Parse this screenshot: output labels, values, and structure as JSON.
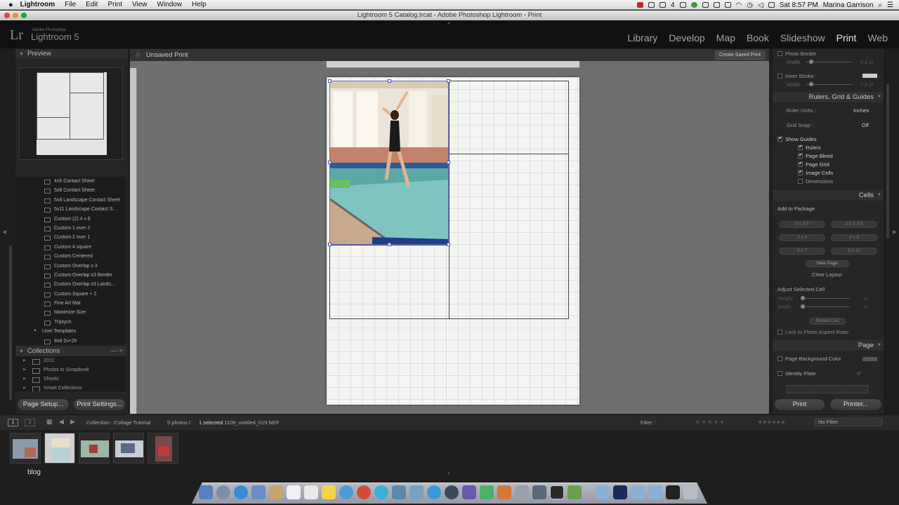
{
  "menubar": {
    "apple": "",
    "app": "Lightroom",
    "items": [
      "File",
      "Edit",
      "Print",
      "View",
      "Window",
      "Help"
    ],
    "status_num": "4",
    "datetime": "Sat 8:57 PM",
    "user": "Marina Garrison"
  },
  "window_title": "Lightroom 5 Catalog.lrcat - Adobe Photoshop Lightroom - Print",
  "lr": {
    "logo": "Lr",
    "subtitle": "Adobe Photoshop",
    "name": "Lightroom 5",
    "modules": [
      "Library",
      "Develop",
      "Map",
      "Book",
      "Slideshow",
      "Print",
      "Web"
    ],
    "active_module": "Print"
  },
  "left_panel": {
    "preview_title": "Preview",
    "templates": [
      "4x5 Contact Sheet",
      "5x8 Contact Sheet",
      "5x9 Landscape Contact Sheet",
      "5x11 Landscape Contact S...",
      "Custom (2) 4 x 6",
      "Custom 1 over 2",
      "Custom 2 over 1",
      "Custom 4 square",
      "Custom Centered",
      "Custom Overlap x 3",
      "Custom Overlap x3 Border",
      "Custom Overlap x3 Lands...",
      "Custom Square + 2",
      "Fine Art Mat",
      "Maximize Size",
      "Triptych"
    ],
    "user_templates_label": "User Templates",
    "user_templates": [
      "8x8 2v+2h"
    ],
    "collections_title": "Collections",
    "collections_ctrl": "— +",
    "collections": [
      "2011",
      "Photos to Scrapbook",
      "Shoots",
      "Smart Collections"
    ],
    "page_setup": "Page Setup...",
    "print_settings": "Print Settings..."
  },
  "canvas": {
    "title": "Unsaved Print",
    "create_saved": "Create Saved Print"
  },
  "right_panel": {
    "photo_border": "Photo Border",
    "width_label": "Width",
    "width_unit": "0.0 pt",
    "inner_stroke": "Inner Stroke",
    "rulers_title": "Rulers, Grid & Guides",
    "ruler_units_label": "Ruler Units :",
    "ruler_units_value": "Inches",
    "grid_snap_label": "Grid Snap :",
    "grid_snap_value": "Off",
    "show_guides": "Show Guides",
    "guides": [
      "Rulers",
      "Page Bleed",
      "Page Grid",
      "Image Cells",
      "Dimensions"
    ],
    "cells_title": "Cells",
    "add_to_package": "Add to Package",
    "sizes": [
      "2 x 2.5",
      "2.5 x 3.5",
      "3 x 4",
      "4 x 6",
      "5 x 7",
      "8 x 10"
    ],
    "new_page": "New Page",
    "clear_layout": "Clear Layout",
    "adjust_cell": "Adjust Selected Cell",
    "height_label": "Height",
    "width2_label": "Width",
    "in_unit": "in",
    "rotate_cell": "Rotate Cell",
    "lock_aspect": "Lock to Photo Aspect Ratio",
    "page_title": "Page",
    "page_bg": "Page Background Color",
    "identity_plate": "Identity Plate",
    "identity_rot": "0°",
    "print": "Print",
    "printer": "Printer..."
  },
  "filmbar": {
    "page1": "1",
    "page2": "2",
    "collection": "Collection : Collage Tutorial",
    "count": "5 photos /",
    "selected": "1 selected",
    "filename": "/ 1109_untitled_019.NEF",
    "filter_label": "Filter :",
    "filter_value": "No Filter"
  },
  "bottom_label": "blog",
  "colors": {
    "accent_red": "#c62828",
    "selected_cell": "#6a6ad4"
  }
}
